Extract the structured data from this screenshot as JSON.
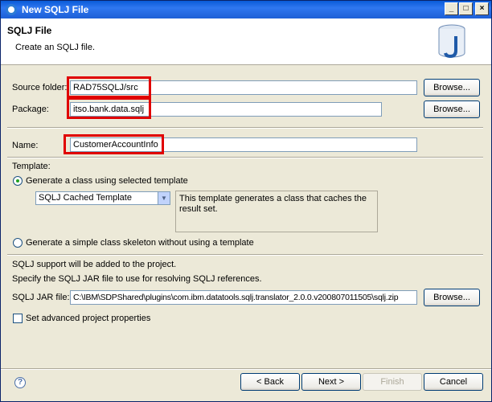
{
  "window": {
    "title": "New SQLJ File"
  },
  "header": {
    "title": "SQLJ File",
    "description": "Create an SQLJ file."
  },
  "source_folder": {
    "label": "Source folder:",
    "value": "RAD75SQLJ/src",
    "browse": "Browse..."
  },
  "package": {
    "label": "Package:",
    "value": "itso.bank.data.sqlj",
    "browse": "Browse..."
  },
  "name": {
    "label": "Name:",
    "value": "CustomerAccountInfo"
  },
  "template": {
    "label": "Template:",
    "option_selected": "Generate a class using selected template",
    "combo_value": "SQLJ Cached Template",
    "description": "This template generates a class that caches the result set.",
    "option_simple": "Generate a simple class skeleton without using a template"
  },
  "sqlj": {
    "support_note": "SQLJ support will be added to the project.",
    "specify_note": "Specify the SQLJ JAR file to use for resolving SQLJ references.",
    "jar_label": "SQLJ JAR file:",
    "jar_value": "C:\\IBM\\SDPShared\\plugins\\com.ibm.datatools.sqlj.translator_2.0.0.v200807011505\\sqlj.zip",
    "browse": "Browse...",
    "advanced": "Set advanced project properties"
  },
  "footer": {
    "back": "< Back",
    "next": "Next >",
    "finish": "Finish",
    "cancel": "Cancel"
  },
  "colors": {
    "highlight": "#e00000",
    "titlebar": "#0a5bd8"
  }
}
